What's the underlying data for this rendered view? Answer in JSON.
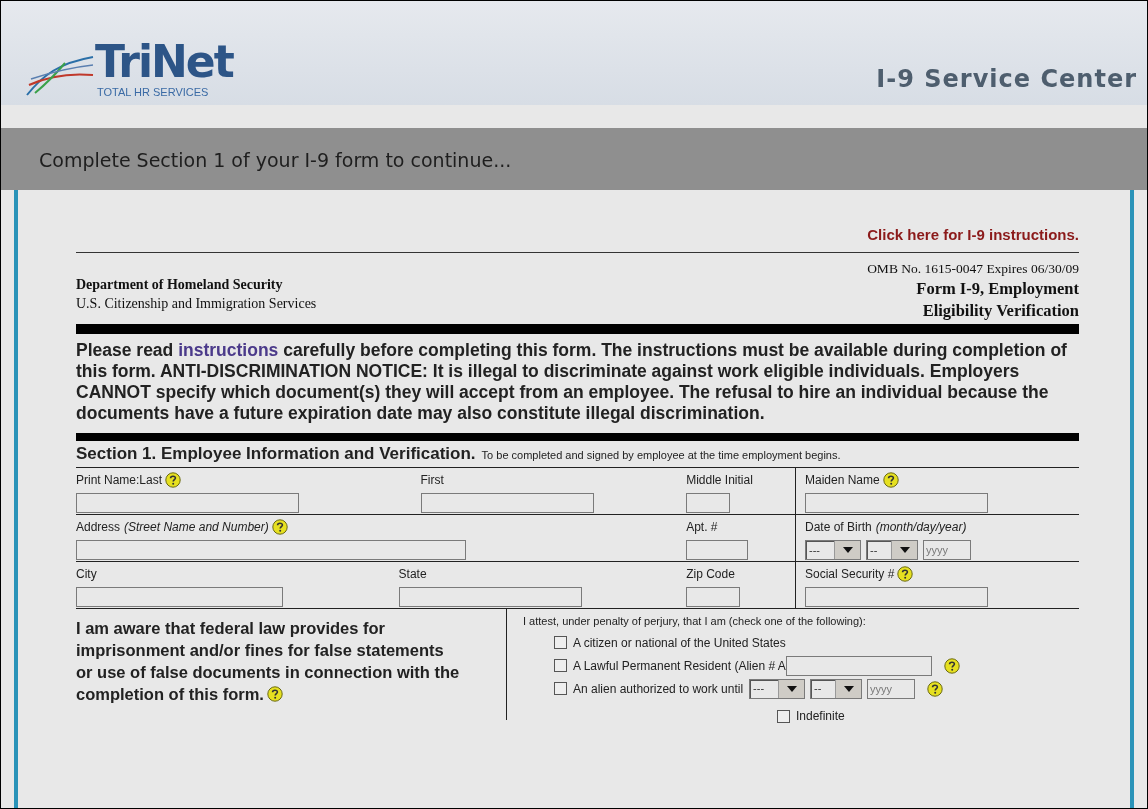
{
  "header": {
    "logo_name": "TriNet",
    "logo_tagline": "TOTAL HR SERVICES",
    "title": "I-9 Service Center"
  },
  "banner": "Complete Section 1 of your I-9 form to continue...",
  "form": {
    "instructions_link": "Click here for I-9 instructions.",
    "agency": "Department of Homeland Security",
    "agency_sub": "U.S. Citizenship and Immigration Services",
    "omb": "OMB No. 1615-0047 Expires 06/30/09",
    "form_title_lines": [
      "Form I-9, Employment",
      "Eligibility Verification"
    ],
    "notice": {
      "before": "Please read",
      "link": "instructions",
      "after": "carefully before completing this form. The instructions must be available during completion of this form. ANTI-DISCRIMINATION NOTICE: It is illegal to discriminate against work eligible individuals. Employers CANNOT specify which document(s) they will accept from an employee. The refusal to hire an individual because the documents have a future expiration date may also constitute illegal discrimination."
    },
    "section": {
      "title": "Section 1. Employee Information and Verification.",
      "subtitle": "To be completed and signed by employee at the time employment begins."
    },
    "rows": [
      {
        "left": [
          {
            "label": "Print Name:Last",
            "help": true
          },
          {
            "label": "First",
            "help": false
          },
          {
            "label": "Middle Initial",
            "help": false
          }
        ],
        "right": {
          "kind": "text",
          "label": "Maiden Name",
          "help": true
        }
      },
      {
        "left": [
          {
            "label": "Address",
            "note": "(Street Name and Number)",
            "help": true
          },
          {
            "label": "Apt. #",
            "help": false
          }
        ],
        "right": {
          "kind": "date",
          "label": "Date of Birth",
          "note": "(month/day/year)",
          "help": false,
          "month": "---",
          "day": "--",
          "year_placeholder": "yyyy"
        }
      },
      {
        "left": [
          {
            "label": "City",
            "help": false
          },
          {
            "label": "State",
            "help": false
          },
          {
            "label": "Zip Code",
            "help": false
          }
        ],
        "right": {
          "kind": "text",
          "label": "Social Security #",
          "help": true
        }
      }
    ],
    "penalty": {
      "text": "I am aware that federal law provides for imprisonment and/or fines for false statements or use of false documents in connection with the completion of this form.",
      "help": true
    },
    "attest": {
      "prompt": "I attest, under penalty of perjury, that I am (check one of the following):",
      "options": [
        {
          "kind": "plain",
          "label": "A citizen or national of the United States",
          "checked": false
        },
        {
          "kind": "text",
          "label": "A Lawful Permanent Resident (Alien # A",
          "checked": false,
          "help": true
        },
        {
          "kind": "date",
          "label": "An alien authorized to work until",
          "checked": false,
          "help": true,
          "month": "---",
          "day": "--",
          "year_placeholder": "yyyy"
        }
      ],
      "indefinite": {
        "label": "Indefinite",
        "checked": false
      }
    }
  }
}
